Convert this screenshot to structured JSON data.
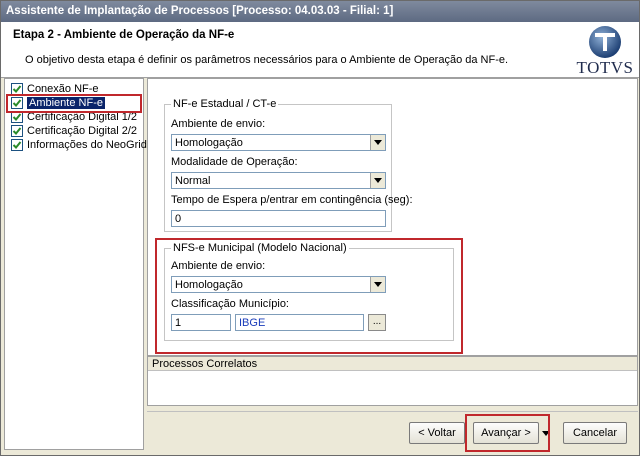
{
  "window": {
    "title": "Assistente de Implantação de Processos [Processo: 04.03.03 - Filial: 1]"
  },
  "header": {
    "step_title": "Etapa 2 - Ambiente de Operação da NF-e",
    "description": "O objetivo desta etapa é definir os parâmetros necessários para o Ambiente de Operação da NF-e.",
    "logo_text": "TOTVS"
  },
  "sidebar": {
    "items": [
      {
        "label": "Conexão NF-e",
        "checked": true,
        "selected": false
      },
      {
        "label": "Ambiente NF-e",
        "checked": true,
        "selected": true
      },
      {
        "label": "Certificação Digital 1/2",
        "checked": true,
        "selected": false
      },
      {
        "label": "Certificação Digital 2/2",
        "checked": true,
        "selected": false
      },
      {
        "label": "Informações do NeoGrid",
        "checked": true,
        "selected": false
      }
    ]
  },
  "nfe_estadual": {
    "legend": "NF-e Estadual / CT-e",
    "ambiente_label": "Ambiente de envio:",
    "ambiente_value": "Homologação",
    "modalidade_label": "Modalidade de Operação:",
    "modalidade_value": "Normal",
    "tempo_label": "Tempo de Espera p/entrar em contingência (seg):",
    "tempo_value": "0"
  },
  "nfse_municipal": {
    "legend": "NFS-e Municipal (Modelo Nacional)",
    "ambiente_label": "Ambiente de envio:",
    "ambiente_value": "Homologação",
    "classificacao_label": "Classificação Município:",
    "classificacao_code": "1",
    "classificacao_name": "IBGE",
    "lookup_label": "..."
  },
  "processos_correlatos": {
    "title": "Processos Correlatos"
  },
  "footer": {
    "voltar_label": "< Voltar",
    "avancar_label": "Avançar >",
    "cancelar_label": "Cancelar"
  },
  "colors": {
    "highlight": "#c0282c",
    "selection": "#0a246a",
    "titlebar": "#5d6a82",
    "check": "#2a8a2a"
  }
}
